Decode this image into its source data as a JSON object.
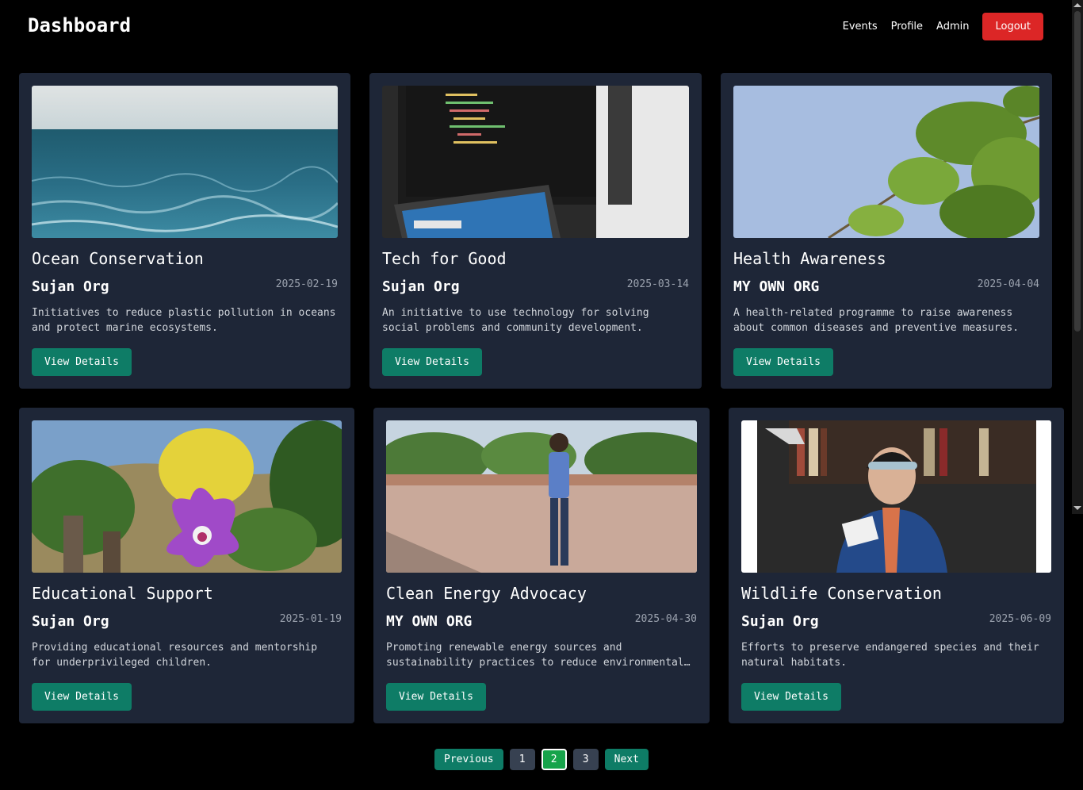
{
  "header": {
    "title": "Dashboard",
    "nav": [
      "Events",
      "Profile",
      "Admin"
    ],
    "logout_label": "Logout",
    "logout_color": "#dc2626"
  },
  "cards": [
    {
      "title": "Ocean Conservation",
      "org": "Sujan Org",
      "date": "2025-02-19",
      "description": "Initiatives to reduce plastic pollution in oceans and protect marine ecosystems.",
      "button": "View Details",
      "image": "ocean-waves"
    },
    {
      "title": "Tech for Good",
      "org": "Sujan Org",
      "date": "2025-03-14",
      "description": "An initiative to use technology for solving social problems and community development.",
      "button": "View Details",
      "image": "code-monitor-laptop"
    },
    {
      "title": "Health Awareness",
      "org": "MY OWN ORG",
      "date": "2025-04-04",
      "description": "A health-related programme to raise awareness about common diseases and preventive measures.",
      "button": "View Details",
      "image": "tree-branch-sky"
    },
    {
      "title": "Educational Support",
      "org": "Sujan Org",
      "date": "2025-01-19",
      "description": "Providing educational resources and mentorship for underprivileged children.",
      "button": "View Details",
      "image": "purple-orchid"
    },
    {
      "title": "Clean Energy Advocacy",
      "org": "MY OWN ORG",
      "date": "2025-04-30",
      "description": "Promoting renewable energy sources and sustainability practices to reduce environmental impact.",
      "button": "View Details",
      "image": "man-on-terrace"
    },
    {
      "title": "Wildlife Conservation",
      "org": "Sujan Org",
      "date": "2025-06-09",
      "description": "Efforts to preserve endangered species and their natural habitats.",
      "button": "View Details",
      "image": "woman-reading-library"
    }
  ],
  "pagination": {
    "previous": "Previous",
    "pages": [
      "1",
      "2",
      "3"
    ],
    "current": "2",
    "next": "Next"
  },
  "colors": {
    "accent": "#0e7c66",
    "card_bg": "#1e2637",
    "page_bg": "#000000",
    "active_page": "#16a34a"
  }
}
